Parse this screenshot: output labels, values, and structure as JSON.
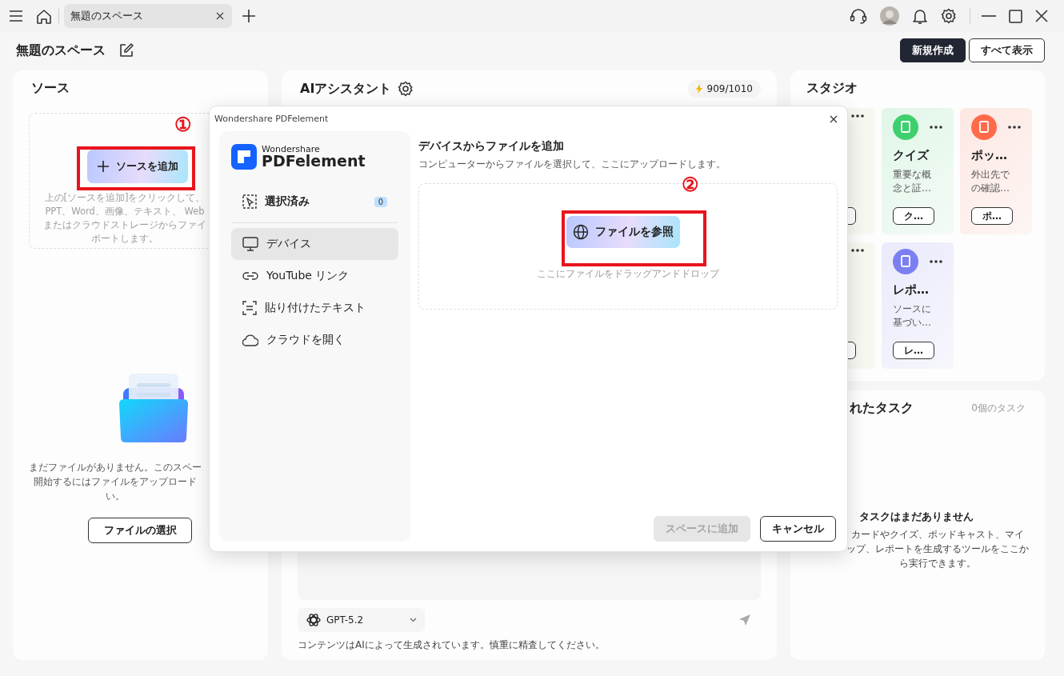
{
  "title_bar": {
    "tabs": [
      {
        "label": "無題のスペース",
        "selected": true
      }
    ]
  },
  "space": {
    "title": "無題のスペース",
    "buttons": [
      {
        "label": "新規作成",
        "kind": "primary"
      },
      {
        "label": "すべて表示",
        "kind": "secondary"
      }
    ]
  },
  "sources": {
    "title": "ソース",
    "add_button": "ソースを追加",
    "hint": [
      "上の[ソースを追加]をクリックして、",
      "PPT、Word、画像、テキスト、 Web",
      "またはクラウドストレージからファイ",
      "ポートします。"
    ],
    "empty_message": [
      "まだファイルがありません。このスペー",
      "開始するにはファイルをアップロード",
      "い。"
    ],
    "select_button": "ファイルの選択"
  },
  "assistant": {
    "title": "AIアシスタント",
    "credits": "909/1010",
    "model": "GPT-5.2",
    "disclaimer": "コンテンツはAIによって生成されています。慎重に精査してください。"
  },
  "studio": {
    "title": "スタジオ",
    "cards": [
      {
        "kind": "covered"
      },
      {
        "kind": "tool",
        "color": "#3ecf6e",
        "title": "クイズ",
        "description": [
          "重要な概",
          "念と証…"
        ],
        "button": "ク…"
      },
      {
        "kind": "tool",
        "color": "#ff6b4a",
        "title": "ポッ…",
        "description": [
          "外出先で",
          "の確認…"
        ],
        "button": "ポ…"
      },
      {
        "kind": "covered"
      },
      {
        "kind": "tool",
        "color": "#7c7ff2",
        "title": "レポ…",
        "description": [
          "ソースに",
          "基づい…"
        ],
        "button": "レ…"
      }
    ]
  },
  "tasks": {
    "title": "れたタスク",
    "count": "0個のタスク",
    "empty_title": "タスクはまだありません",
    "empty_text": [
      "カードやクイズ、ポッドキャスト、マイ",
      "ップ、レポートを生成するツールをここか",
      "ら実行できます。"
    ]
  },
  "dialog": {
    "title": "Wondershare PDFelement",
    "logo": {
      "small": "Wondershare",
      "large": "PDFelement"
    },
    "nav": [
      {
        "label": "選択済み",
        "kind": "summary",
        "badge": "0",
        "selected": false
      },
      {
        "label": "デバイス",
        "kind": "source",
        "selected": true
      },
      {
        "label": "YouTube リンク",
        "kind": "source",
        "selected": false
      },
      {
        "label": "貼り付けたテキスト",
        "kind": "source",
        "selected": false
      },
      {
        "label": "クラウドを開く",
        "kind": "source",
        "selected": false
      }
    ],
    "heading": "デバイスからファイルを追加",
    "subheading": "コンピューターからファイルを選択して、ここにアップロードします。",
    "browse_button": "ファイルを参照",
    "drop_hint": "ここにファイルをドラッグアンドドロップ",
    "buttons": [
      {
        "label": "スペースに追加",
        "kind": "primary",
        "disabled": true
      },
      {
        "label": "キャンセル",
        "kind": "secondary",
        "disabled": false
      }
    ]
  },
  "annotations": [
    {
      "label": "①"
    },
    {
      "label": "②"
    }
  ]
}
